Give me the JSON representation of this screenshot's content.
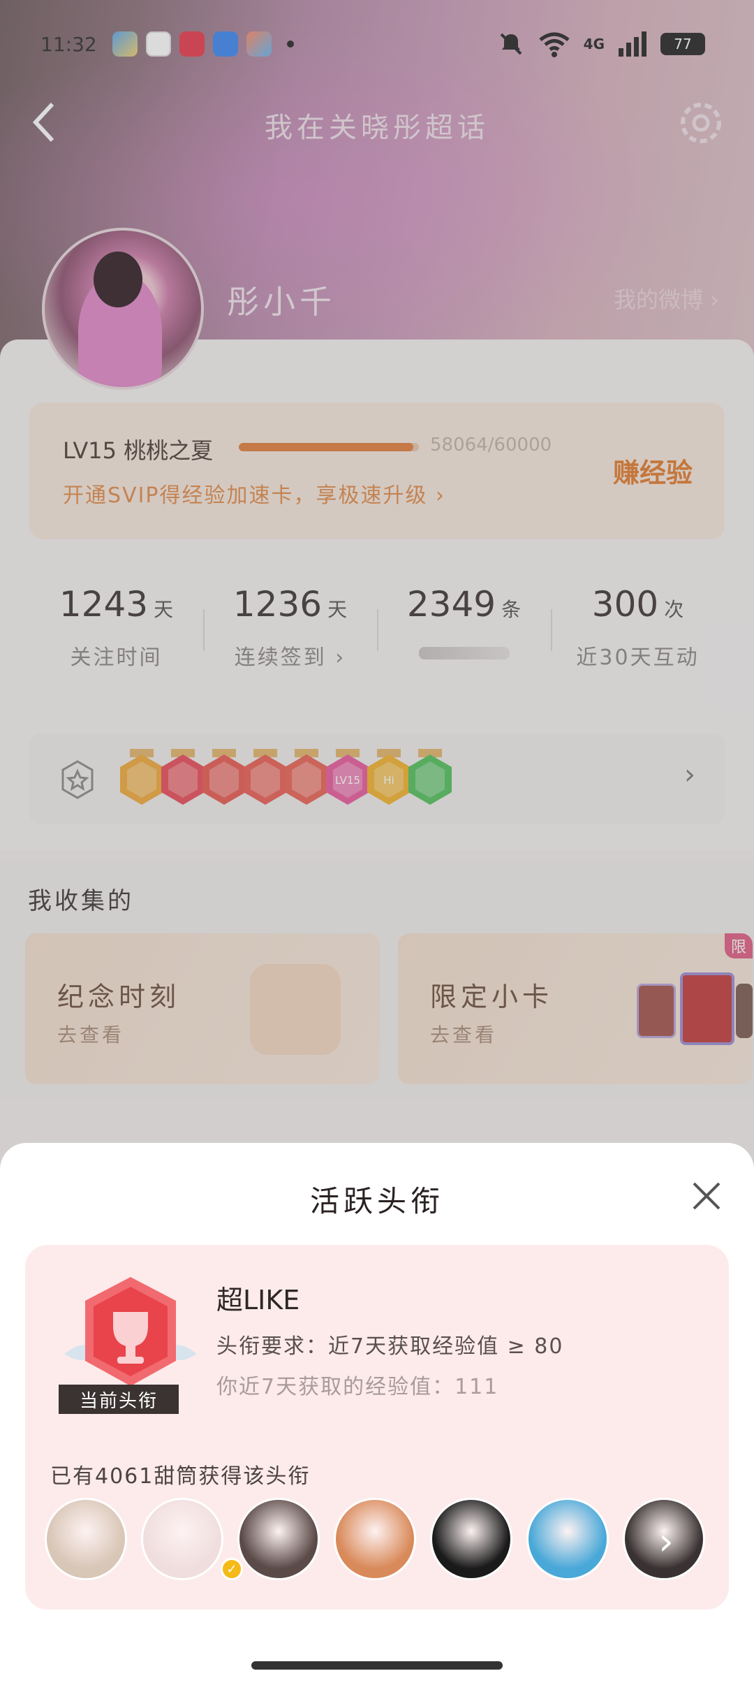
{
  "status_bar": {
    "time": "11:32",
    "network": "4G",
    "battery": "77"
  },
  "header": {
    "title": "我在关晓彤超话",
    "user_name": "彤小千",
    "my_weibo": "我的微博 ›"
  },
  "level": {
    "label": "LV15 桃桃之夏",
    "exp_text": "58064/60000",
    "exp_progress": 0.968,
    "promo": "开通SVIP得经验加速卡，享极速升级 ›",
    "earn_label": "赚经验"
  },
  "stats": [
    {
      "value": "1243",
      "unit": "天",
      "label": "关注时间"
    },
    {
      "value": "1236",
      "unit": "天",
      "label": "连续签到 ›"
    },
    {
      "value": "2349",
      "unit": "条",
      "label": ""
    },
    {
      "value": "300",
      "unit": "次",
      "label": "近30天互动"
    }
  ],
  "badges": {
    "items": [
      {
        "name": "crown-badge",
        "color": "#f0a838"
      },
      {
        "name": "trophy-badge",
        "color": "#e94a57"
      },
      {
        "name": "cat-badge",
        "color": "#e9584f"
      },
      {
        "name": "cat-badge-2",
        "color": "#ea5d52"
      },
      {
        "name": "cat-badge-3",
        "color": "#ea6152"
      },
      {
        "name": "lv15-badge",
        "color": "#e9589d",
        "text": "LV15"
      },
      {
        "name": "hi-badge",
        "color": "#f3b22a",
        "text": "Hi"
      },
      {
        "name": "hand-badge",
        "color": "#4fc05a"
      }
    ]
  },
  "collection": {
    "title": "我收集的",
    "cards": [
      {
        "name": "纪念时刻",
        "sub": "去查看"
      },
      {
        "name": "限定小卡",
        "sub": "去查看",
        "tag": "限"
      }
    ]
  },
  "sheet": {
    "title": "活跃头衔",
    "badge_tag": "当前头衔",
    "title_name": "超LIKE",
    "requirement": "头衔要求：近7天获取经验值 ≥ 80",
    "my_exp": "你近7天获取的经验值：111",
    "owners_text": "已有4061甜筒获得该头衔",
    "owner_avatars": [
      "#d8c6b6",
      "#f0dede",
      "#5a4a48",
      "#d98a5a",
      "#1a1a1a",
      "#49a8d8",
      "#3a3232"
    ]
  },
  "colors": {
    "accent": "#e07d3a",
    "badge_red": "#e94a57"
  }
}
